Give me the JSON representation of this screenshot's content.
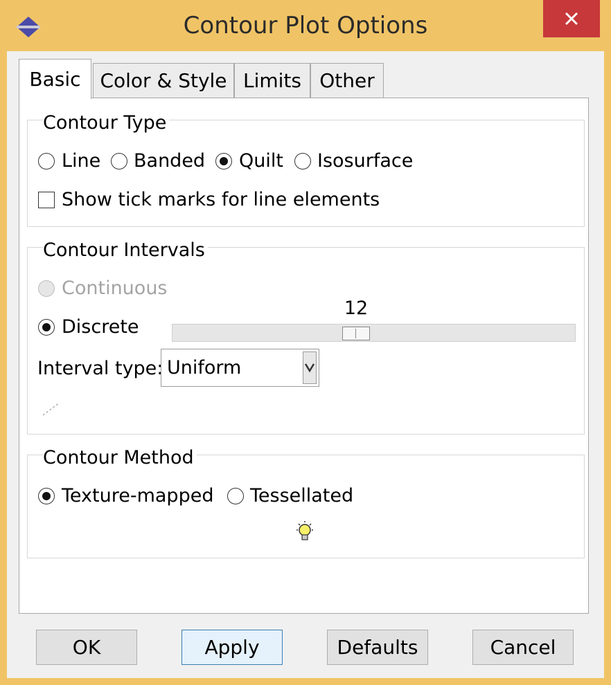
{
  "window": {
    "title": "Contour Plot Options",
    "close_glyph": "✕",
    "frame_color": "#f0c466",
    "close_color": "#c7383a"
  },
  "tabs": [
    {
      "label": "Basic",
      "active": true
    },
    {
      "label": "Color & Style",
      "active": false
    },
    {
      "label": "Limits",
      "active": false
    },
    {
      "label": "Other",
      "active": false
    }
  ],
  "contour_type": {
    "legend": "Contour Type",
    "options": [
      {
        "label": "Line",
        "checked": false
      },
      {
        "label": "Banded",
        "checked": false
      },
      {
        "label": "Quilt",
        "checked": true
      },
      {
        "label": "Isosurface",
        "checked": false
      }
    ],
    "tick_marks_label": "Show tick marks for line elements",
    "tick_marks_checked": false
  },
  "contour_intervals": {
    "legend": "Contour Intervals",
    "continuous_label": "Continuous",
    "continuous_enabled": false,
    "discrete_label": "Discrete",
    "discrete_checked": true,
    "slider_value": "12",
    "interval_type_label": "Interval type:",
    "interval_type_value": "Uniform"
  },
  "contour_method": {
    "legend": "Contour Method",
    "options": [
      {
        "label": "Texture-mapped",
        "checked": true
      },
      {
        "label": "Tessellated",
        "checked": false
      }
    ],
    "hint_icon": "lightbulb-icon"
  },
  "buttons": {
    "ok": "OK",
    "apply": "Apply",
    "defaults": "Defaults",
    "cancel": "Cancel"
  }
}
